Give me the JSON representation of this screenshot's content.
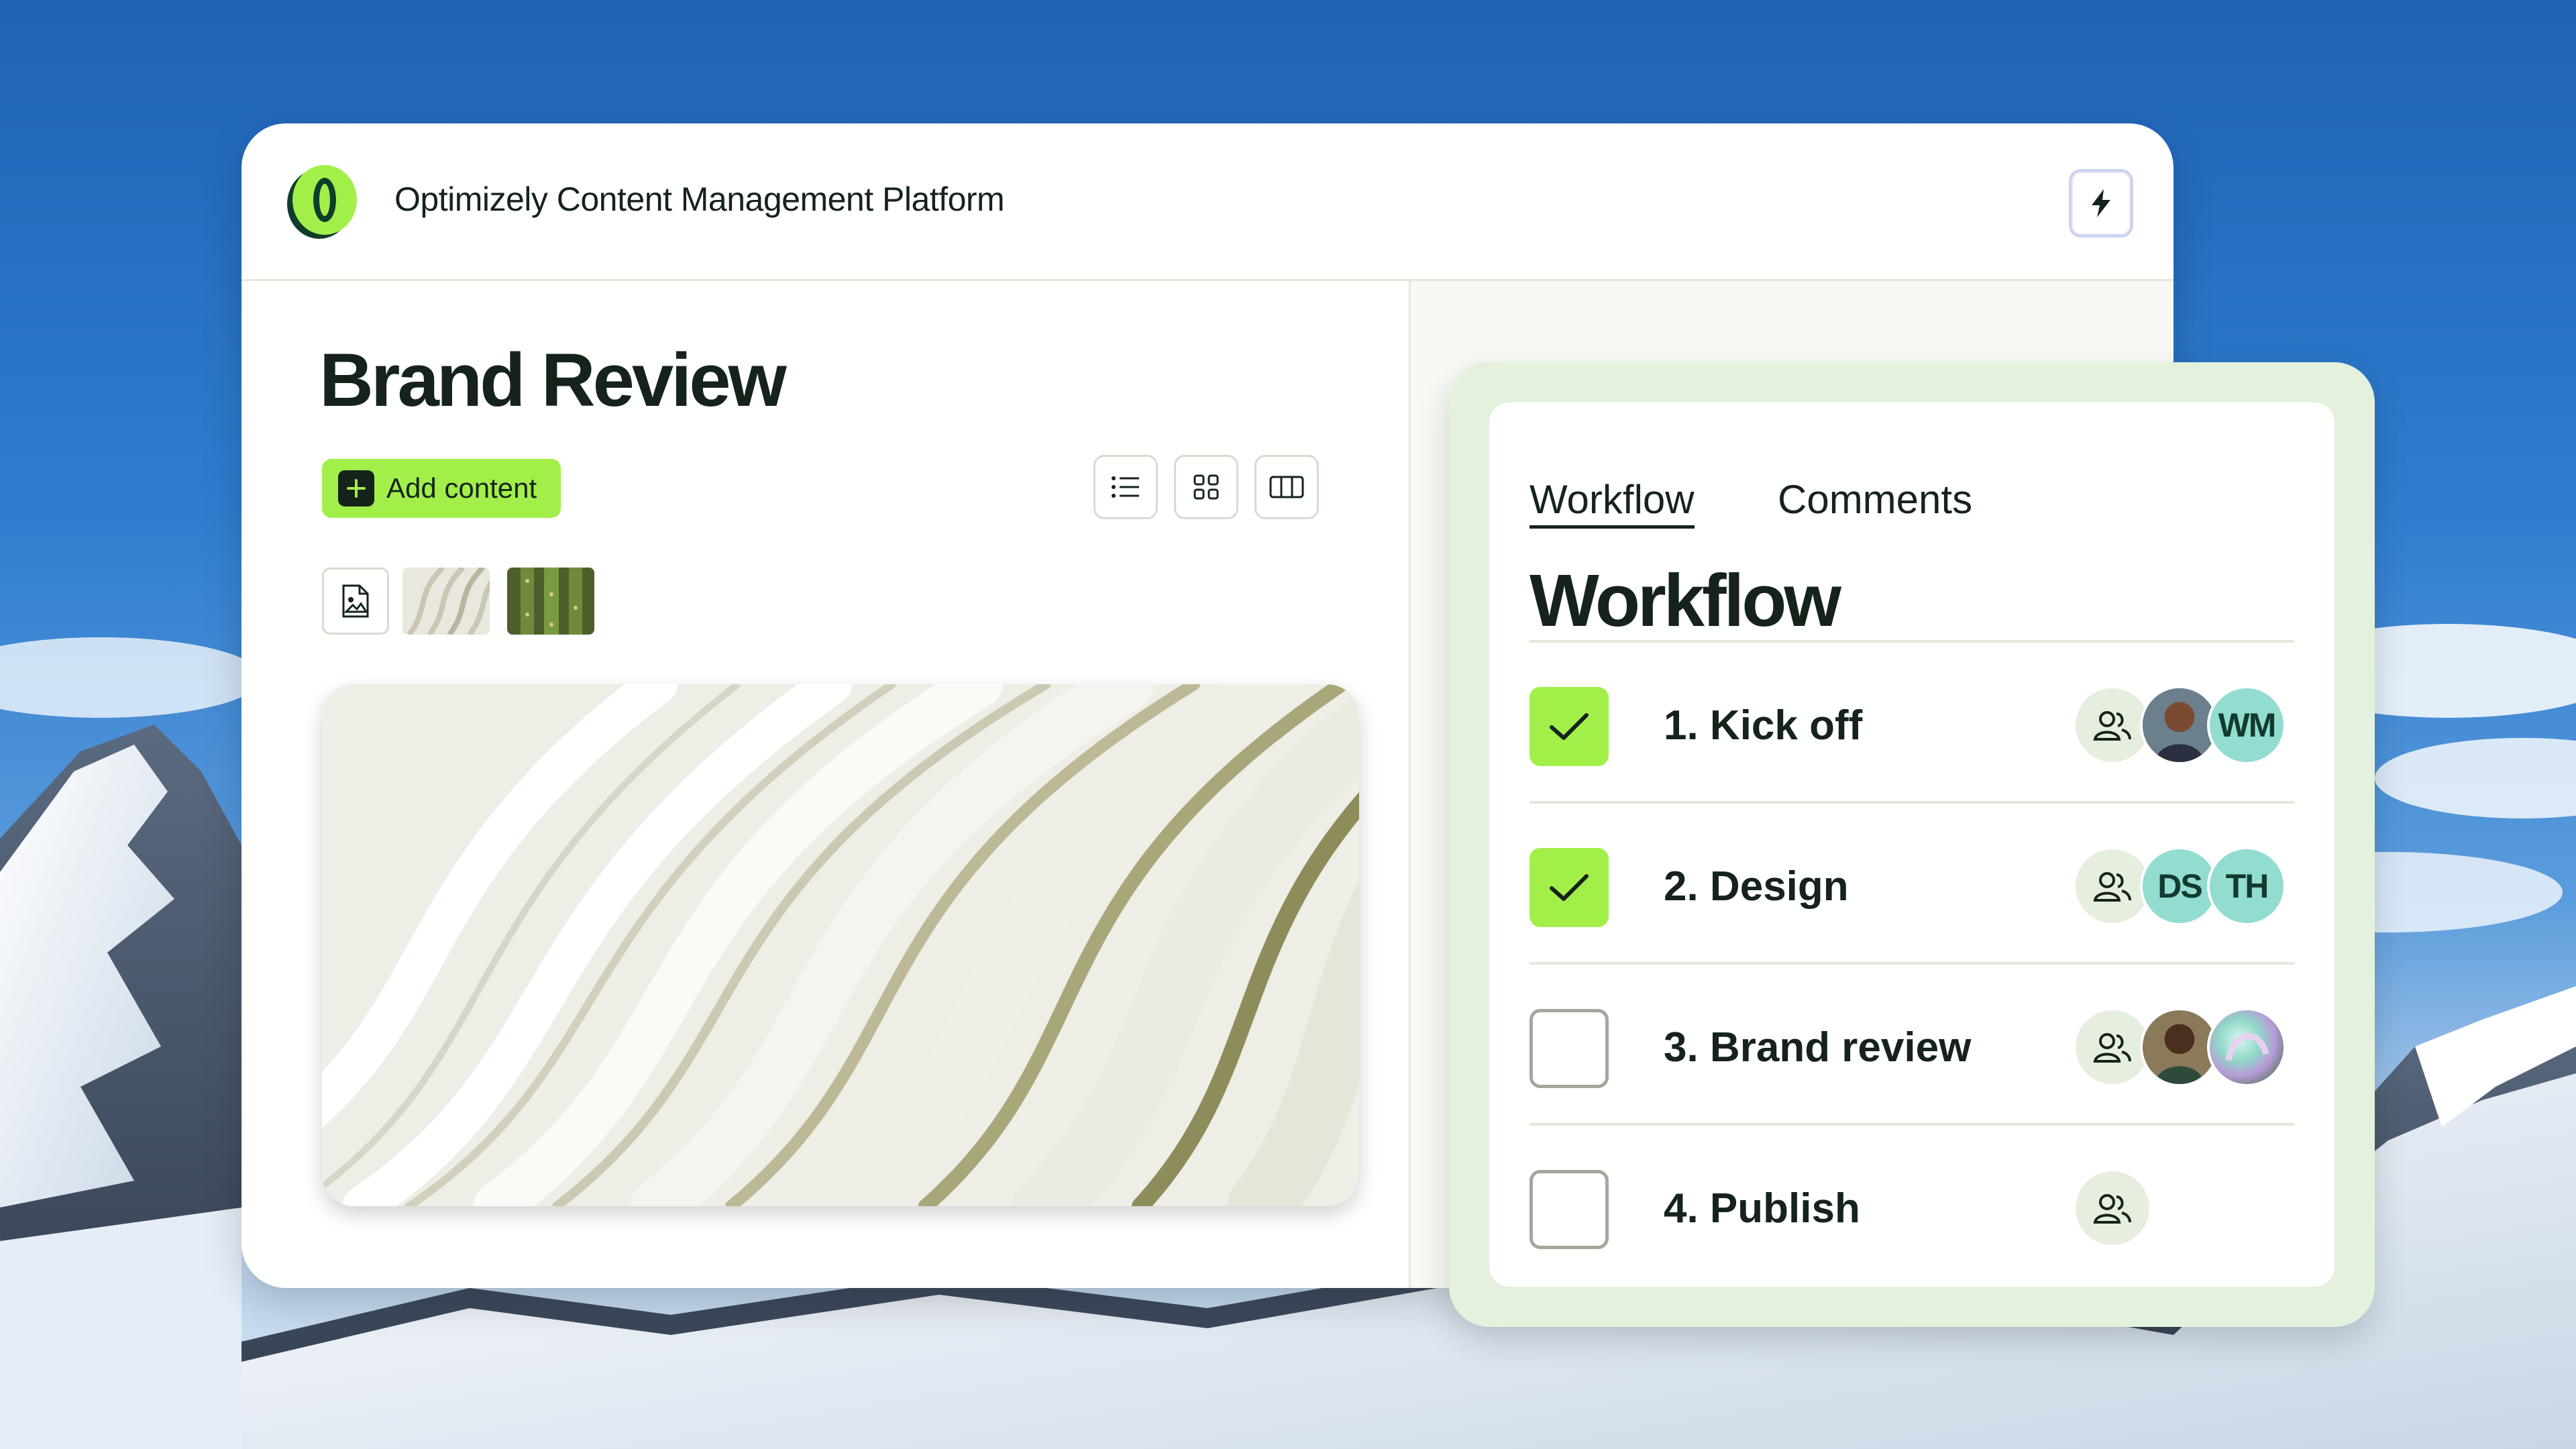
{
  "app": {
    "title": "Optimizely Content Management Platform",
    "logo_icon": "optimizely-logo-icon",
    "action_icon": "lightning-bolt-icon"
  },
  "page": {
    "title": "Brand Review",
    "add_button_label": "Add content",
    "view_buttons": [
      "list-view-icon",
      "grid-view-icon",
      "columns-view-icon"
    ],
    "thumbnails": [
      "image-file-icon",
      "white-waves-thumbnail",
      "cactus-thumbnail"
    ]
  },
  "workflow": {
    "tabs": [
      {
        "label": "Workflow",
        "active": true
      },
      {
        "label": "Comments",
        "active": false
      }
    ],
    "title": "Workflow",
    "steps": [
      {
        "label": "1. Kick off",
        "done": true,
        "assignees": [
          "photo",
          "WM"
        ]
      },
      {
        "label": "2. Design",
        "done": true,
        "assignees": [
          "DS",
          "TH"
        ]
      },
      {
        "label": "3. Brand review",
        "done": false,
        "assignees": [
          "photo",
          "abstract-avatar"
        ]
      },
      {
        "label": "4. Publish",
        "done": false,
        "assignees": []
      }
    ]
  },
  "colors": {
    "accent_green": "#a3ef4a",
    "panel_tint": "#e4f1dc",
    "initials_avatar": "#92dcd0",
    "text_dark": "#15231a"
  }
}
